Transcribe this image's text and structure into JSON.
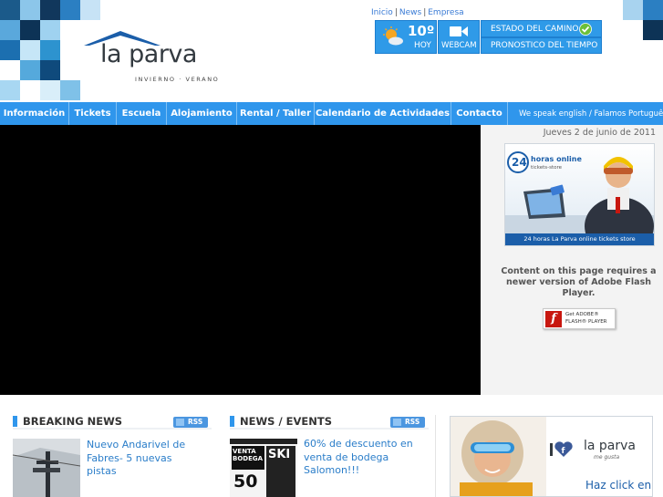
{
  "logo": {
    "text": "la parva",
    "subtitle": "INVIERNO · VERANO"
  },
  "top_links": [
    "Inicio",
    "News",
    "Empresa"
  ],
  "weather": {
    "temperature": "10º",
    "label": "HOY",
    "icon": "sun-cloud-icon"
  },
  "webcam": {
    "label": "WEBCAM",
    "icon": "video-camera-icon"
  },
  "road_status": {
    "label": "ESTADO DEL CAMINO",
    "icon": "check-circle-icon"
  },
  "forecast": {
    "label": "PRONOSTICO DEL TIEMPO"
  },
  "nav": {
    "items": [
      {
        "label": "Información"
      },
      {
        "label": "Tickets"
      },
      {
        "label": "Escuela"
      },
      {
        "label": "Alojamiento"
      },
      {
        "label": "Rental / Taller"
      },
      {
        "label": "Calendario de Actividades"
      },
      {
        "label": "Contacto"
      }
    ],
    "language_note": "We speak english / Falamos Português"
  },
  "sidebar": {
    "date": "Jueves 2 de junio de 2011",
    "banner": {
      "headline": "24",
      "subline": "horas online",
      "small": "tickets-store",
      "footer": "24 horas La Parva online tickets store"
    },
    "flash_message": "Content on this page requires a newer version of Adobe Flash Player.",
    "flash_badge": {
      "line1": "Get ADOBE®",
      "line2": "FLASH® PLAYER"
    }
  },
  "sections": {
    "breaking": {
      "title": "BREAKING NEWS",
      "rss": "RSS",
      "item_title": "Nuevo Andarivel de Fabres- 5 nuevas pistas"
    },
    "events": {
      "title": "NEWS / EVENTS",
      "rss": "RSS",
      "item_title": "60% de descuento en venta de bodega Salomon!!!",
      "image_text": {
        "top": "VENTA BODEGA",
        "pct": "50",
        "side": "SKI"
      }
    }
  },
  "fb_banner": {
    "brand": "la parva",
    "tag": "me gusta",
    "cta": "Haz click en"
  }
}
